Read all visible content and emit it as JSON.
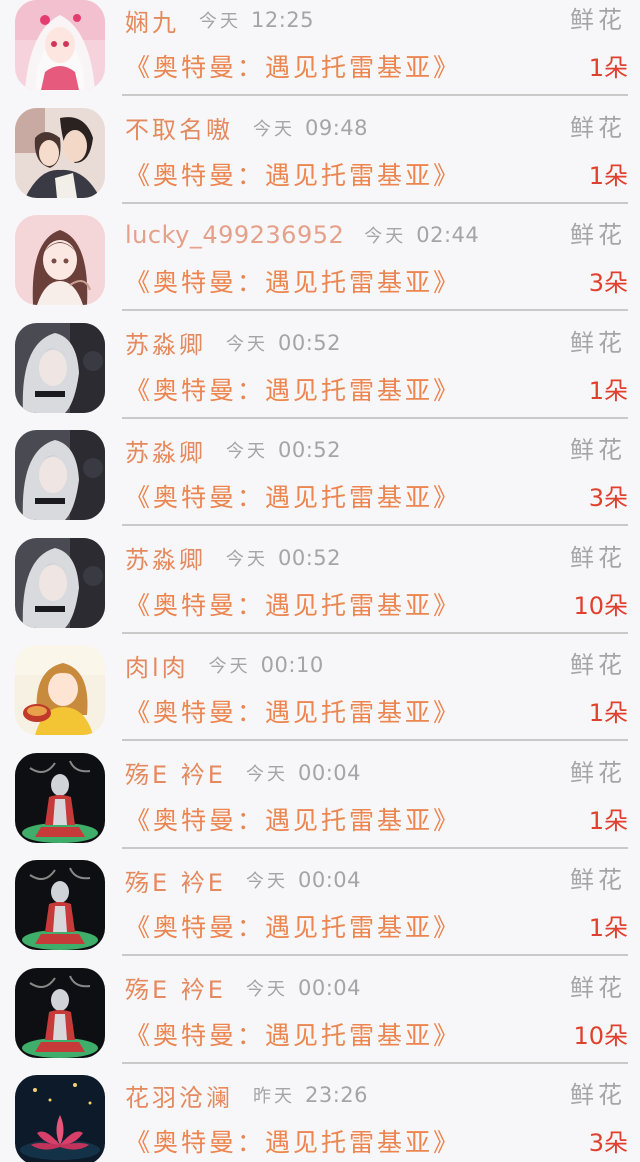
{
  "rows": [
    {
      "user": "娴九",
      "date": "今天",
      "time": "12:25",
      "gift": "鲜花",
      "movie": "《奥特曼：遇见托雷基亚》",
      "count": "1朵",
      "avatar": "avatar-pink-girl"
    },
    {
      "user": "不取名嗷",
      "date": "今天",
      "time": "09:48",
      "gift": "鲜花",
      "movie": "《奥特曼：遇见托雷基亚》",
      "count": "1朵",
      "avatar": "avatar-couple"
    },
    {
      "user": "lucky_499236952",
      "date": "今天",
      "time": "02:44",
      "gift": "鲜花",
      "movie": "《奥特曼：遇见托雷基亚》",
      "count": "3朵",
      "avatar": "avatar-anime-girl"
    },
    {
      "user": "苏淼卿",
      "date": "今天",
      "time": "00:52",
      "gift": "鲜花",
      "movie": "《奥特曼：遇见托雷基亚》",
      "count": "1朵",
      "avatar": "avatar-silver-hair"
    },
    {
      "user": "苏淼卿",
      "date": "今天",
      "time": "00:52",
      "gift": "鲜花",
      "movie": "《奥特曼：遇见托雷基亚》",
      "count": "3朵",
      "avatar": "avatar-silver-hair"
    },
    {
      "user": "苏淼卿",
      "date": "今天",
      "time": "00:52",
      "gift": "鲜花",
      "movie": "《奥特曼：遇见托雷基亚》",
      "count": "10朵",
      "avatar": "avatar-silver-hair"
    },
    {
      "user": "肉l肉",
      "date": "今天",
      "time": "00:10",
      "gift": "鲜花",
      "movie": "《奥特曼：遇见托雷基亚》",
      "count": "1朵",
      "avatar": "avatar-yellow-girl"
    },
    {
      "user": "殇E 衿E",
      "date": "今天",
      "time": "00:04",
      "gift": "鲜花",
      "movie": "《奥特曼：遇见托雷基亚》",
      "count": "1朵",
      "avatar": "avatar-ultraman"
    },
    {
      "user": "殇E 衿E",
      "date": "今天",
      "time": "00:04",
      "gift": "鲜花",
      "movie": "《奥特曼：遇见托雷基亚》",
      "count": "1朵",
      "avatar": "avatar-ultraman"
    },
    {
      "user": "殇E 衿E",
      "date": "今天",
      "time": "00:04",
      "gift": "鲜花",
      "movie": "《奥特曼：遇见托雷基亚》",
      "count": "10朵",
      "avatar": "avatar-ultraman"
    },
    {
      "user": "花羽沧澜",
      "date": "昨天",
      "time": "23:26",
      "gift": "鲜花",
      "movie": "《奥特曼：遇见托雷基亚》",
      "count": "3朵",
      "avatar": "avatar-lotus"
    }
  ],
  "colors": {
    "username": "#e58a5e",
    "meta": "#a5a5a5",
    "movie": "#ec8550",
    "count": "#e0412f",
    "divider": "#c9c9c9",
    "background": "#f7f6f8"
  }
}
